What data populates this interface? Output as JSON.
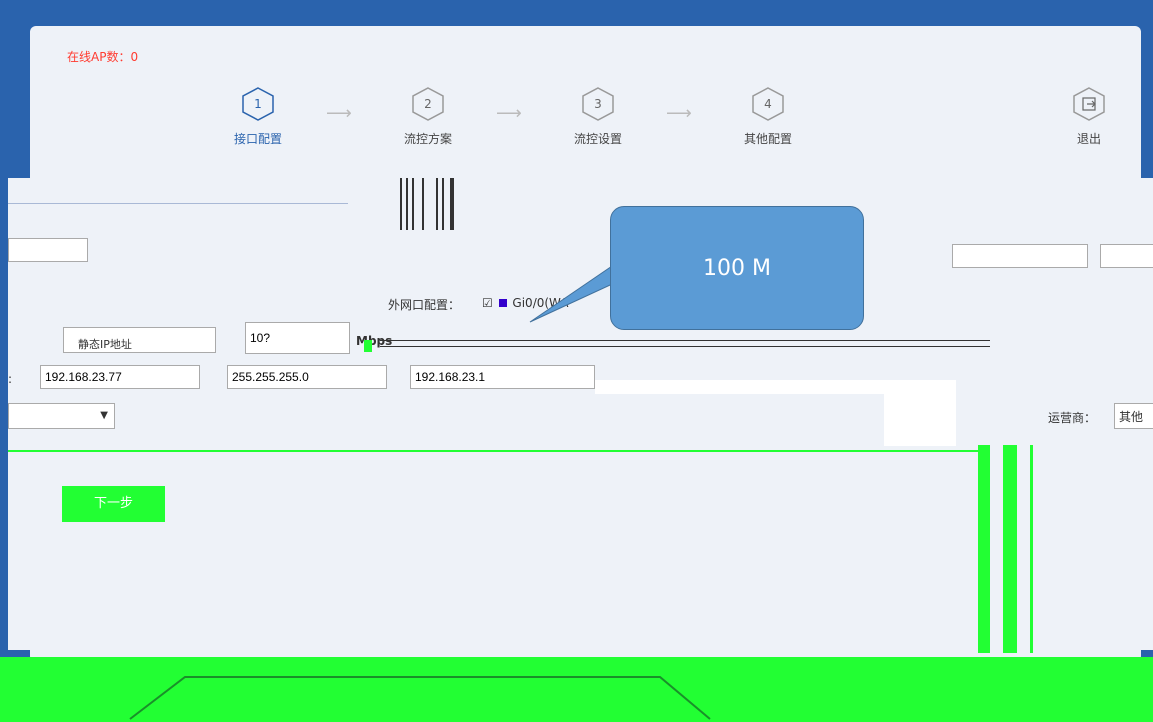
{
  "status": {
    "online_ap_label": "在线AP数：0"
  },
  "steps": [
    {
      "num": "1",
      "label": "接口配置",
      "active": true
    },
    {
      "num": "2",
      "label": "流控方案",
      "active": false
    },
    {
      "num": "3",
      "label": "流控设置",
      "active": false
    },
    {
      "num": "4",
      "label": "其他配置",
      "active": false
    }
  ],
  "logout": {
    "label": "退出"
  },
  "wan": {
    "config_label": "外网口配置：",
    "port_label": "Gi0/0(WA",
    "bandwidth_value": "10?",
    "bandwidth_unit": "Mbps",
    "ip": "192.168.23.77",
    "mask": "255.255.255.0",
    "gateway": "192.168.23.1",
    "mode_value": "静态IP地址"
  },
  "operator": {
    "label": "运营商：",
    "value": "其他"
  },
  "callout": {
    "text": "100 M"
  },
  "buttons": {
    "next": "下一步"
  },
  "colors": {
    "header_blue": "#2a63ad",
    "panel_bg": "#eef2f8",
    "green_artifact": "#22ff33",
    "callout_fill": "#5b9bd5"
  }
}
